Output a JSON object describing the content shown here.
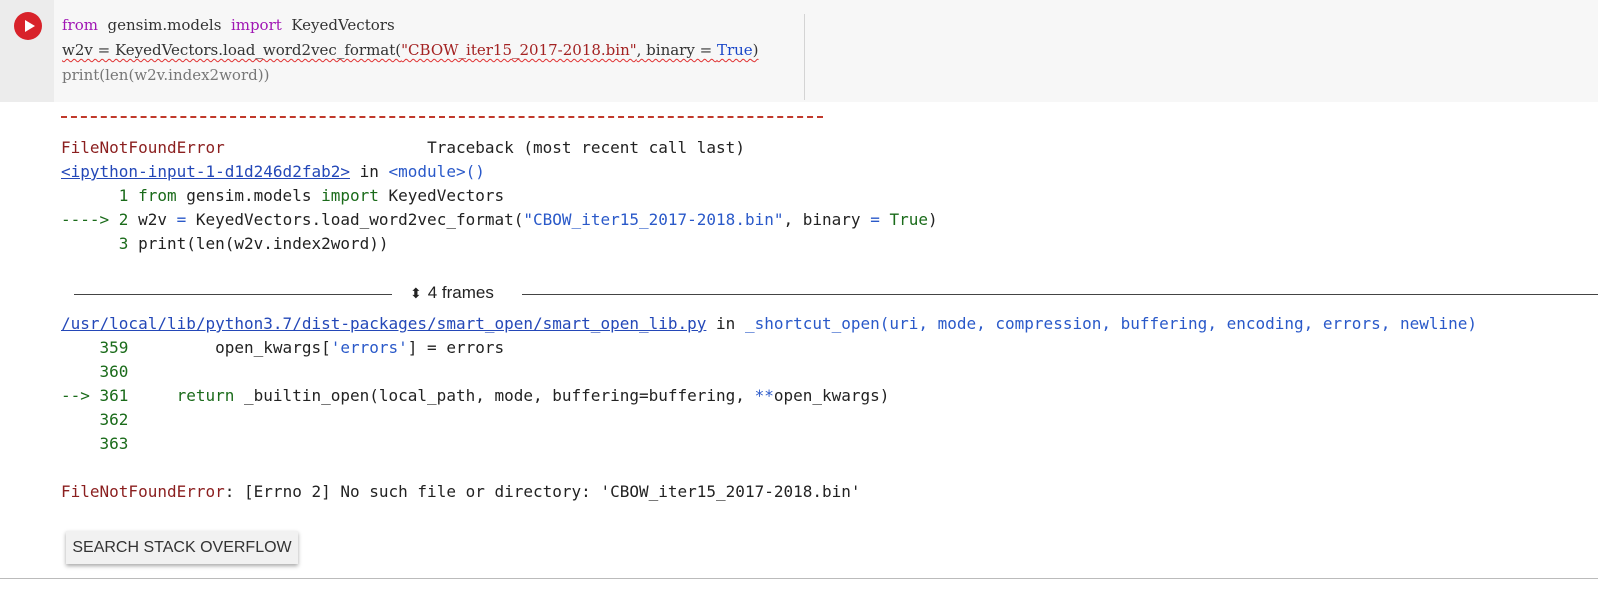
{
  "cell": {
    "code_line1": {
      "kw1": "from",
      "mod": "gensim.models",
      "kw2": "import",
      "name": "KeyedVectors"
    },
    "code_line2": {
      "pre": "w2v = KeyedVectors.load_word2vec_format(",
      "str": "\"CBOW_iter15_2017-2018.bin\"",
      "mid": ", binary = ",
      "val": "True",
      "post": ")"
    },
    "code_line3": "print(len(w2v.index2word))"
  },
  "output": {
    "error_name": "FileNotFoundError",
    "traceback_header": "Traceback (most recent call last)",
    "input_link": "<ipython-input-1-d1d246d2fab2>",
    "in_word": " in ",
    "module": "<module>()",
    "tb1_num": "      1 ",
    "tb1_code": {
      "kw1": "from",
      "mod": " gensim.models ",
      "kw2": "import",
      "rest": " KeyedVectors"
    },
    "tb2_arrow": "----> 2 ",
    "tb2_code": {
      "pre": "w2v ",
      "eq": "=",
      "mid": " KeyedVectors.load_word2vec_format(",
      "str": "\"CBOW_iter15_2017-2018.bin\"",
      "mid2": ", binary ",
      "eq2": "=",
      "val": " True",
      "post": ")"
    },
    "tb3_num": "      3 ",
    "tb3_code": "print(len(w2v.index2word))",
    "frames_label": "4 frames",
    "lib_link": "/usr/local/lib/python3.7/dist-packages/smart_open/smart_open_lib.py",
    "func": "_shortcut_open",
    "func_args": "(uri, mode, compression, buffering, encoding, errors, newline)",
    "l359_num": "    359 ",
    "l359_code": {
      "pre": "        open_kwargs[",
      "str": "'errors'",
      "post": "] = errors"
    },
    "l360_num": "    360 ",
    "l361_arrow": "--> 361 ",
    "l361_code": {
      "kw": "    return",
      "rest": " _builtin_open(local_path, mode, buffering=buffering, ",
      "op": "**",
      "rest2": "open_kwargs)"
    },
    "l362_num": "    362 ",
    "l363_num": "    363 ",
    "final_error_name": "FileNotFoundError",
    "final_error_msg": ": [Errno 2] No such file or directory: 'CBOW_iter15_2017-2018.bin'"
  },
  "button": {
    "so_label": "SEARCH STACK OVERFLOW"
  }
}
